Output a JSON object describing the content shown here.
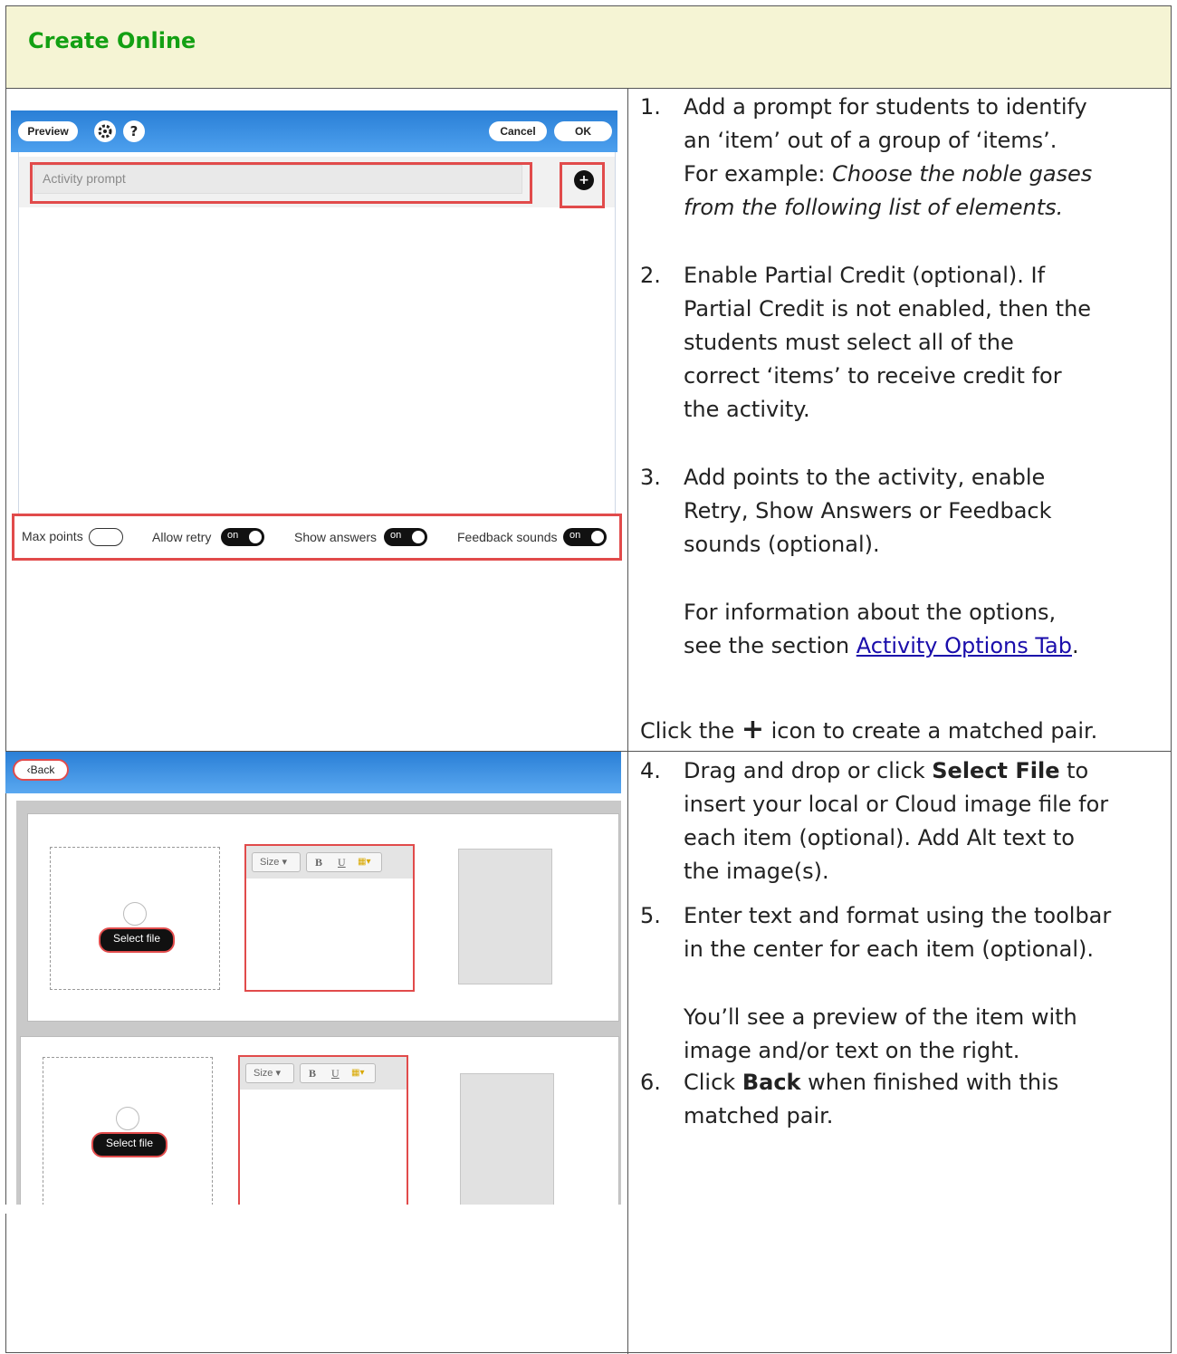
{
  "header": {
    "title": "Create Online"
  },
  "screenshot1": {
    "preview_button": "Preview",
    "gear_icon": "gear-icon",
    "help_icon": "?",
    "cancel_button": "Cancel",
    "ok_button": "OK",
    "prompt_placeholder": "Activity prompt",
    "add_icon": "+",
    "options": {
      "max_points": "Max points",
      "allow_retry": "Allow retry",
      "show_answers": "Show answers",
      "feedback_sounds": "Feedback sounds",
      "toggle_on": "on"
    }
  },
  "screenshot2": {
    "back_button": "Back",
    "select_file": "Select file",
    "toolbar": {
      "size": "Size",
      "bold": "B",
      "underline": "U"
    }
  },
  "steps": {
    "s1_num": "1.",
    "s1_l1": "Add a prompt for students to identify",
    "s1_l2": "an ‘item’ out of a group of ‘items’.",
    "s1_l3_a": "For example: ",
    "s1_l3_b": "Choose the noble gases",
    "s1_l4": "from the following list of elements.",
    "s2_num": "2.",
    "s2_l1": "Enable Partial Credit (optional). If",
    "s2_l2": "Partial Credit is not enabled, then the",
    "s2_l3": "students must select all of the",
    "s2_l4": "correct ‘items’ to receive credit for",
    "s2_l5": "the activity.",
    "s3_num": "3.",
    "s3_l1": "Add points to the activity, enable",
    "s3_l2": "Retry, Show Answers or Feedback",
    "s3_l3": "sounds (optional).",
    "info_l1": "For information about the options,",
    "info_l2_a": "see the section ",
    "info_link": "Activity Options Tab",
    "info_l2_c": ".",
    "click_a": "Click the ",
    "click_icon": "+",
    "click_b": " icon to create a matched pair.",
    "s4_num": "4.",
    "s4_l1_a": "Drag and drop or click ",
    "s4_l1_b": "Select File",
    "s4_l1_c": " to",
    "s4_l2": "insert your local or Cloud image file for",
    "s4_l3": "each item (optional). Add Alt text to",
    "s4_l4": "the image(s).",
    "s5_num": "5.",
    "s5_l1": "Enter text and format using the toolbar",
    "s5_l2": "in the center for each item (optional).",
    "s5_note1": "You’ll see a preview of the item with",
    "s5_note2": "image and/or text on the right.",
    "s6_num": "6.",
    "s6_l1_a": "Click ",
    "s6_l1_b": "Back",
    "s6_l1_c": " when finished with this",
    "s6_l2": "matched pair."
  }
}
